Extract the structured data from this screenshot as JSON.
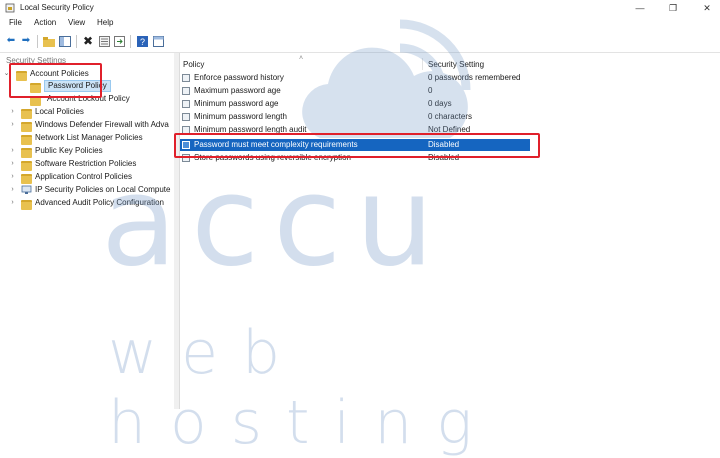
{
  "window": {
    "title": "Local Security Policy",
    "minimize": "—",
    "maximize": "❐",
    "close": "✕"
  },
  "menu": [
    "File",
    "Action",
    "View",
    "Help"
  ],
  "tree": {
    "root": "Security Settings",
    "items": [
      {
        "label": "Account Policies",
        "expanded": true
      },
      {
        "label": "Password Policy",
        "selected": true
      },
      {
        "label": "Account Lockout Policy"
      },
      {
        "label": "Local Policies"
      },
      {
        "label": "Windows Defender Firewall with Adva"
      },
      {
        "label": "Network List Manager Policies"
      },
      {
        "label": "Public Key Policies"
      },
      {
        "label": "Software Restriction Policies"
      },
      {
        "label": "Application Control Policies"
      },
      {
        "label": "IP Security Policies on Local Compute"
      },
      {
        "label": "Advanced Audit Policy Configuration"
      }
    ]
  },
  "list": {
    "columns": [
      "Policy",
      "Security Setting"
    ],
    "rows": [
      {
        "policy": "Enforce password history",
        "setting": "0 passwords remembered"
      },
      {
        "policy": "Maximum password age",
        "setting": "0"
      },
      {
        "policy": "Minimum password age",
        "setting": "0 days"
      },
      {
        "policy": "Minimum password length",
        "setting": "0 characters"
      },
      {
        "policy": "Minimum password length audit",
        "setting": "Not Defined"
      },
      {
        "policy": "Password must meet complexity requirements",
        "setting": "Disabled",
        "selected": true
      },
      {
        "policy": "Store passwords using reversible encryption",
        "setting": "Disabled"
      }
    ]
  },
  "watermark": {
    "brand": "accu",
    "tagline": "web hosting"
  },
  "colors": {
    "selection": "#1565c0",
    "highlight_box": "#e0202b",
    "watermark": "#6f95c4"
  }
}
